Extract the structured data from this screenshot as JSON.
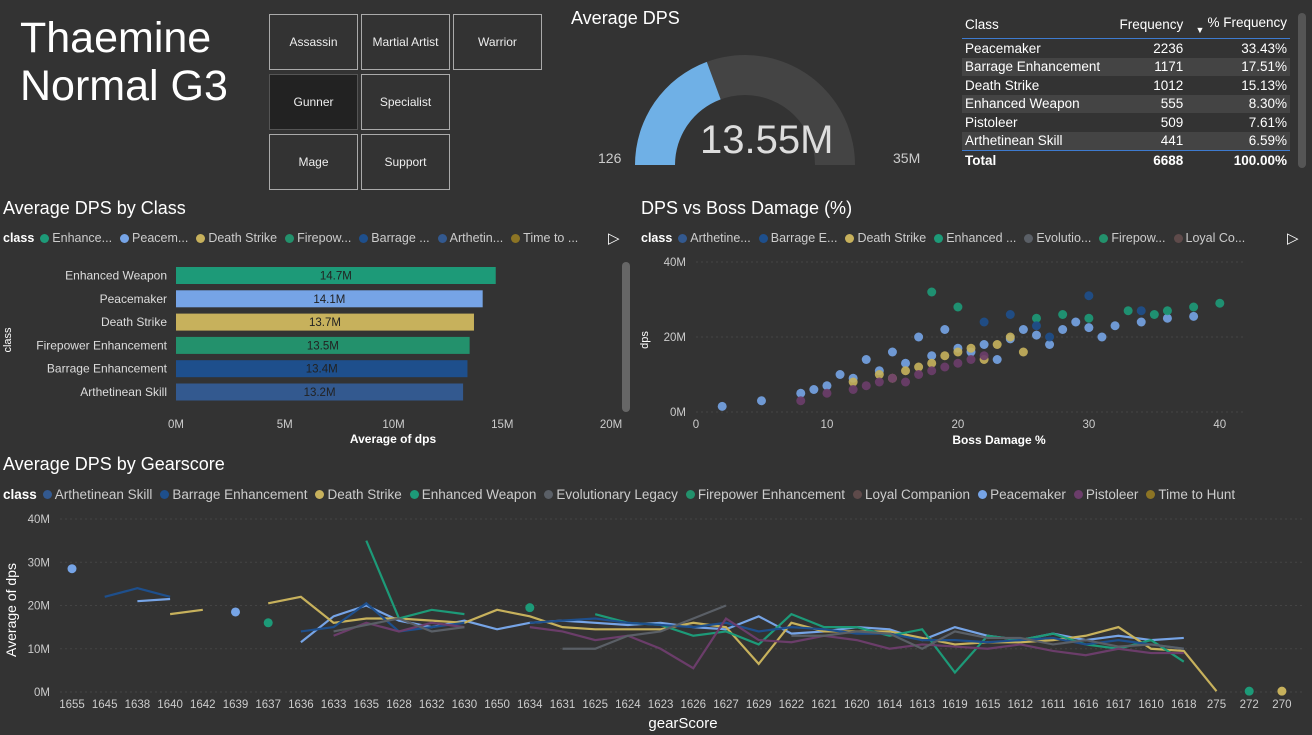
{
  "title_line1": "Thaemine",
  "title_line2": "Normal G3",
  "slicer": [
    "Assassin",
    "Martial Artist",
    "Warrior",
    "Gunner",
    "Specialist",
    "Mage",
    "Support"
  ],
  "slicer_selected": "Gunner",
  "gauge": {
    "title": "Average DPS",
    "value_label": "13.55M",
    "min_label": "126",
    "max_label": "35M",
    "fraction": 0.387,
    "color": "#6fb0e6"
  },
  "freq_table": {
    "headers": [
      "Class",
      "Frequency",
      "% Frequency"
    ],
    "rows": [
      [
        "Peacemaker",
        "2236",
        "33.43%"
      ],
      [
        "Barrage Enhancement",
        "1171",
        "17.51%"
      ],
      [
        "Death Strike",
        "1012",
        "15.13%"
      ],
      [
        "Enhanced Weapon",
        "555",
        "8.30%"
      ],
      [
        "Pistoleer",
        "509",
        "7.61%"
      ],
      [
        "Arthetinean Skill",
        "441",
        "6.59%"
      ]
    ],
    "total": [
      "Total",
      "6688",
      "100.00%"
    ]
  },
  "chart1": {
    "title": "Average DPS by Class",
    "legend_label": "class",
    "legend": [
      {
        "name": "Enhance...",
        "color": "#1d9a78"
      },
      {
        "name": "Peacem...",
        "color": "#76a4e6"
      },
      {
        "name": "Death Strike",
        "color": "#c7b15c"
      },
      {
        "name": "Firepow...",
        "color": "#23916c"
      },
      {
        "name": "Barrage ...",
        "color": "#1e4f8c"
      },
      {
        "name": "Arthetin...",
        "color": "#33598f"
      },
      {
        "name": "Time to ...",
        "color": "#8c7424"
      }
    ],
    "yaxis_label": "class",
    "xaxis_label": "Average of dps",
    "xticks": [
      "0M",
      "5M",
      "10M",
      "15M",
      "20M"
    ]
  },
  "chart2": {
    "title": "DPS vs Boss Damage (%)",
    "legend_label": "class",
    "legend": [
      {
        "name": "Arthetine...",
        "color": "#33598f"
      },
      {
        "name": "Barrage E...",
        "color": "#1e4f8c"
      },
      {
        "name": "Death Strike",
        "color": "#c7b15c"
      },
      {
        "name": "Enhanced ...",
        "color": "#1d9a78"
      },
      {
        "name": "Evolutio...",
        "color": "#5a5f66"
      },
      {
        "name": "Firepow...",
        "color": "#23916c"
      },
      {
        "name": "Loyal Co...",
        "color": "#5e4a4a"
      }
    ],
    "yaxis_label": "dps",
    "xaxis_label": "Boss Damage %",
    "yticks": [
      "40M",
      "20M",
      "0M"
    ],
    "xticks": [
      "0",
      "10",
      "20",
      "30",
      "40"
    ]
  },
  "chart3": {
    "title": "Average DPS by Gearscore",
    "legend_label": "class",
    "legend": [
      {
        "name": "Arthetinean Skill",
        "color": "#33598f"
      },
      {
        "name": "Barrage Enhancement",
        "color": "#1e4f8c"
      },
      {
        "name": "Death Strike",
        "color": "#c7b15c"
      },
      {
        "name": "Enhanced Weapon",
        "color": "#1d9a78"
      },
      {
        "name": "Evolutionary Legacy",
        "color": "#5a5f66"
      },
      {
        "name": "Firepower Enhancement",
        "color": "#23916c"
      },
      {
        "name": "Loyal Companion",
        "color": "#5e4a4a"
      },
      {
        "name": "Peacemaker",
        "color": "#76a4e6"
      },
      {
        "name": "Pistoleer",
        "color": "#6b3d6a"
      },
      {
        "name": "Time to Hunt",
        "color": "#8c7424"
      }
    ],
    "yaxis_label": "Average of dps",
    "xaxis_label": "gearScore",
    "yticks": [
      "40M",
      "30M",
      "20M",
      "10M",
      "0M"
    ]
  },
  "chart_data": [
    {
      "type": "bar",
      "title": "Average DPS by Class",
      "categories": [
        "Enhanced Weapon",
        "Peacemaker",
        "Death Strike",
        "Firepower Enhancement",
        "Barrage Enhancement",
        "Arthetinean Skill"
      ],
      "values": [
        14.7,
        14.1,
        13.7,
        13.5,
        13.4,
        13.2
      ],
      "labels": [
        "14.7M",
        "14.1M",
        "13.7M",
        "13.5M",
        "13.4M",
        "13.2M"
      ],
      "colors": [
        "#1d9a78",
        "#76a4e6",
        "#c7b15c",
        "#23916c",
        "#1e4f8c",
        "#33598f"
      ],
      "xlabel": "Average of dps",
      "ylabel": "class",
      "xlim": [
        0,
        20
      ]
    },
    {
      "type": "scatter",
      "title": "DPS vs Boss Damage (%)",
      "xlabel": "Boss Damage %",
      "ylabel": "dps",
      "xlim": [
        0,
        42
      ],
      "ylim": [
        0,
        40
      ],
      "series": [
        {
          "name": "Peacemaker",
          "color": "#76a4e6",
          "points": [
            [
              2,
              1.5
            ],
            [
              5,
              3
            ],
            [
              8,
              5
            ],
            [
              10,
              7
            ],
            [
              12,
              9
            ],
            [
              14,
              11
            ],
            [
              16,
              13
            ],
            [
              18,
              15
            ],
            [
              20,
              17
            ],
            [
              22,
              18
            ],
            [
              24,
              19.5
            ],
            [
              26,
              20.5
            ],
            [
              28,
              22
            ],
            [
              30,
              22.5
            ],
            [
              32,
              23
            ],
            [
              34,
              24
            ],
            [
              36,
              25
            ],
            [
              38,
              25.5
            ],
            [
              17,
              20
            ],
            [
              19,
              22
            ],
            [
              21,
              16
            ],
            [
              23,
              14
            ],
            [
              25,
              22
            ],
            [
              27,
              18
            ],
            [
              29,
              24
            ],
            [
              31,
              20
            ],
            [
              13,
              14
            ],
            [
              15,
              16
            ],
            [
              11,
              10
            ],
            [
              9,
              6
            ]
          ]
        },
        {
          "name": "Death Strike",
          "color": "#c7b15c",
          "points": [
            [
              14,
              10
            ],
            [
              16,
              11
            ],
            [
              18,
              13
            ],
            [
              19,
              15
            ],
            [
              20,
              16
            ],
            [
              21,
              17
            ],
            [
              22,
              14
            ],
            [
              23,
              18
            ],
            [
              17,
              12
            ],
            [
              15,
              9
            ],
            [
              24,
              20
            ],
            [
              25,
              16
            ],
            [
              12,
              8
            ]
          ]
        },
        {
          "name": "Pistoleer",
          "color": "#6b3d6a",
          "points": [
            [
              12,
              6
            ],
            [
              13,
              7
            ],
            [
              14,
              8
            ],
            [
              15,
              9
            ],
            [
              16,
              8
            ],
            [
              17,
              10
            ],
            [
              18,
              11
            ],
            [
              19,
              12
            ],
            [
              20,
              13
            ],
            [
              21,
              14
            ],
            [
              22,
              15
            ],
            [
              10,
              5
            ],
            [
              8,
              3
            ]
          ]
        },
        {
          "name": "Enhanced Weapon",
          "color": "#1d9a78",
          "points": [
            [
              18,
              32
            ],
            [
              20,
              28
            ],
            [
              28,
              26
            ],
            [
              33,
              27
            ],
            [
              36,
              27
            ],
            [
              40,
              29
            ],
            [
              38,
              28
            ],
            [
              30,
              25
            ],
            [
              26,
              25
            ],
            [
              35,
              26
            ]
          ]
        },
        {
          "name": "Barrage Enhancement",
          "color": "#1e4f8c",
          "points": [
            [
              22,
              24
            ],
            [
              26,
              23
            ],
            [
              30,
              31
            ],
            [
              34,
              27
            ],
            [
              24,
              26
            ],
            [
              27,
              20
            ]
          ]
        }
      ]
    },
    {
      "type": "line",
      "title": "Average DPS by Gearscore",
      "xlabel": "gearScore",
      "ylabel": "Average of dps",
      "ylim": [
        0,
        40
      ],
      "x": [
        "1655",
        "1645",
        "1638",
        "1640",
        "1642",
        "1639",
        "1637",
        "1636",
        "1633",
        "1635",
        "1628",
        "1632",
        "1630",
        "1650",
        "1634",
        "1631",
        "1625",
        "1624",
        "1623",
        "1626",
        "1627",
        "1629",
        "1622",
        "1621",
        "1620",
        "1614",
        "1613",
        "1619",
        "1615",
        "1612",
        "1611",
        "1616",
        "1617",
        "1610",
        "1618",
        "275",
        "272",
        "270"
      ],
      "series": [
        {
          "name": "Peacemaker",
          "color": "#76a4e6",
          "values": [
            28.5,
            null,
            21,
            21.5,
            null,
            18.5,
            null,
            11.5,
            17.5,
            20,
            16.5,
            15,
            16.5,
            14.5,
            16,
            16.5,
            16,
            15.5,
            16,
            15,
            14.5,
            17.5,
            13.5,
            14,
            15,
            14.5,
            12,
            15,
            13,
            12,
            13.5,
            12,
            13,
            12,
            12.5,
            null,
            null,
            null
          ]
        },
        {
          "name": "Death Strike",
          "color": "#c7b15c",
          "values": [
            null,
            null,
            null,
            18,
            19,
            null,
            20.5,
            22,
            16,
            17,
            17,
            16.5,
            16,
            19,
            17.5,
            15,
            14.5,
            14.5,
            14.5,
            16,
            15,
            6.5,
            16,
            14,
            14,
            14,
            12.5,
            11,
            11.5,
            11.5,
            12,
            13,
            15,
            10,
            9.5,
            0.2,
            null,
            0.2
          ]
        },
        {
          "name": "Enhanced Weapon",
          "color": "#1d9a78",
          "values": [
            null,
            null,
            null,
            null,
            null,
            null,
            16,
            null,
            null,
            35,
            17,
            19,
            18,
            null,
            19.5,
            null,
            18,
            16,
            15.5,
            13,
            14,
            11,
            18,
            15,
            15,
            13,
            14.5,
            4.5,
            13,
            12,
            13.5,
            11,
            10,
            12,
            7,
            null,
            0.2,
            null
          ]
        },
        {
          "name": "Barrage Enhancement",
          "color": "#1e4f8c",
          "values": [
            null,
            22,
            24,
            22,
            null,
            null,
            null,
            14,
            15,
            20.5,
            14,
            15,
            16,
            null,
            16,
            16.5,
            17,
            16,
            15.5,
            15,
            16,
            14,
            15,
            14.5,
            13.5,
            13.5,
            12,
            12,
            11.5,
            12,
            12.5,
            11,
            12,
            11,
            10,
            null,
            null,
            null
          ]
        },
        {
          "name": "Pistoleer",
          "color": "#6b3d6a",
          "values": [
            null,
            null,
            null,
            null,
            null,
            null,
            null,
            null,
            13,
            16,
            14,
            16,
            15,
            null,
            15,
            14,
            12,
            13,
            10,
            5.5,
            17,
            12,
            11.5,
            13,
            12,
            10,
            11,
            10.5,
            10,
            11,
            9.5,
            8.5,
            10,
            9,
            9,
            null,
            null,
            null
          ]
        },
        {
          "name": "Evolutionary Legacy",
          "color": "#5a5f66",
          "values": [
            null,
            null,
            null,
            null,
            null,
            null,
            null,
            null,
            14,
            15.5,
            17,
            14,
            15,
            null,
            null,
            10,
            10,
            13,
            14,
            17,
            20,
            null,
            13,
            13,
            14,
            13.5,
            10,
            14,
            12.5,
            12.5,
            11,
            12,
            10.5,
            11,
            10,
            null,
            null,
            null
          ]
        }
      ]
    }
  ]
}
